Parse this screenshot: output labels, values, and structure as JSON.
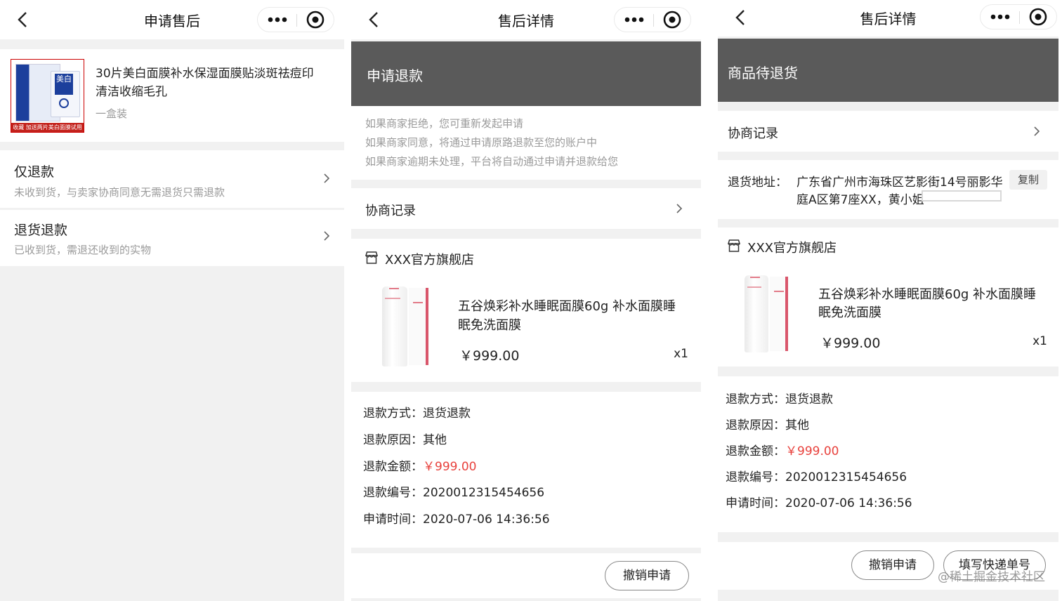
{
  "screen1": {
    "title": "申请售后",
    "product": {
      "name_line1": "30片美白面膜补水保湿面膜贴淡斑祛痘印",
      "name_line2": "清洁收缩毛孔",
      "spec": "一盒装",
      "image_brand": "美白",
      "image_caption": "收藏 加送两片美白面膜试用"
    },
    "options": [
      {
        "title": "仅退款",
        "desc": "未收到货，与卖家协商同意无需退货只需退款"
      },
      {
        "title": "退货退款",
        "desc": "已收到货，需退还收到的实物"
      }
    ]
  },
  "screen2": {
    "title": "售后详情",
    "status": "申请退款",
    "notes": [
      "如果商家拒绝，您可重新发起申请",
      "如果商家同意，将通过申请原路退款至您的账户中",
      "如果商家逾期未处理，平台将自动通过申请并退款给您"
    ],
    "negotiation": "协商记录",
    "shop": "XXX官方旗舰店",
    "product": {
      "name_line1": "五谷焕彩补水睡眠面膜60g 补水面膜睡",
      "name_line2": "眠免洗面膜",
      "price": "￥999.00",
      "qty": "x1"
    },
    "info": [
      {
        "label": "退款方式：",
        "value": "退货退款"
      },
      {
        "label": "退款原因：",
        "value": "其他"
      },
      {
        "label": "退款金额：",
        "value": "￥999.00"
      },
      {
        "label": "退款编号：",
        "value": "2020012315454656"
      },
      {
        "label": "申请时间：",
        "value": "2020-07-06 14:36:56"
      }
    ],
    "cancel_button": "撤销申请"
  },
  "screen3": {
    "title": "售后详情",
    "status": "商品待退货",
    "negotiation": "协商记录",
    "address_label": "退货地址：",
    "address_line1": "广东省广州市海珠区艺影街14号丽影华",
    "address_line2": "庭A区第7座XX，黄小姐",
    "copy_button": "复制",
    "shop": "XXX官方旗舰店",
    "product": {
      "name_line1": "五谷焕彩补水睡眠面膜60g 补水面膜睡",
      "name_line2": "眠免洗面膜",
      "price": "￥999.00",
      "qty": "x1"
    },
    "info": [
      {
        "label": "退款方式：",
        "value": "退货退款"
      },
      {
        "label": "退款原因：",
        "value": "其他"
      },
      {
        "label": "退款金额：",
        "value": "￥999.00"
      },
      {
        "label": "退款编号：",
        "value": "2020012315454656"
      },
      {
        "label": "申请时间：",
        "value": "2020-07-06 14:36:56"
      }
    ],
    "cancel_button": "撤销申请",
    "express_button": "填写快递单号"
  },
  "watermark": "@稀土掘金技术社区",
  "colors": {
    "accent_red": "#e8413c",
    "banner_gray": "#5a5a5a",
    "page_bg": "#f1f1f1"
  },
  "icons": [
    "back-arrow-icon",
    "more-dots-icon",
    "target-close-icon",
    "chevron-right-icon",
    "store-icon"
  ]
}
